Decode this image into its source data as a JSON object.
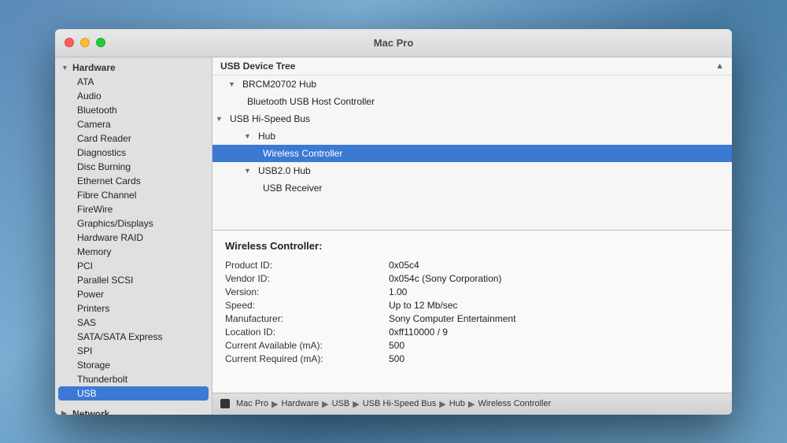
{
  "window": {
    "title": "Mac Pro"
  },
  "sidebar": {
    "sections": [
      {
        "id": "hardware",
        "label": "Hardware",
        "expanded": true,
        "items": [
          {
            "id": "ata",
            "label": "ATA"
          },
          {
            "id": "audio",
            "label": "Audio"
          },
          {
            "id": "bluetooth",
            "label": "Bluetooth"
          },
          {
            "id": "camera",
            "label": "Camera"
          },
          {
            "id": "card-reader",
            "label": "Card Reader"
          },
          {
            "id": "diagnostics",
            "label": "Diagnostics"
          },
          {
            "id": "disc-burning",
            "label": "Disc Burning"
          },
          {
            "id": "ethernet-cards",
            "label": "Ethernet Cards"
          },
          {
            "id": "fibre-channel",
            "label": "Fibre Channel"
          },
          {
            "id": "firewire",
            "label": "FireWire"
          },
          {
            "id": "graphics-displays",
            "label": "Graphics/Displays"
          },
          {
            "id": "hardware-raid",
            "label": "Hardware RAID"
          },
          {
            "id": "memory",
            "label": "Memory"
          },
          {
            "id": "pci",
            "label": "PCI"
          },
          {
            "id": "parallel-scsi",
            "label": "Parallel SCSI"
          },
          {
            "id": "power",
            "label": "Power"
          },
          {
            "id": "printers",
            "label": "Printers"
          },
          {
            "id": "sas",
            "label": "SAS"
          },
          {
            "id": "sata-express",
            "label": "SATA/SATA Express"
          },
          {
            "id": "spi",
            "label": "SPI"
          },
          {
            "id": "storage",
            "label": "Storage"
          },
          {
            "id": "thunderbolt",
            "label": "Thunderbolt"
          },
          {
            "id": "usb",
            "label": "USB",
            "selected": true
          }
        ]
      },
      {
        "id": "network",
        "label": "Network",
        "expanded": false,
        "items": []
      }
    ]
  },
  "tree": {
    "header": "USB Device Tree",
    "items": [
      {
        "id": "hub-brcm",
        "label": "BRCM20702 Hub",
        "indent": 1,
        "triangle": true
      },
      {
        "id": "bt-host",
        "label": "Bluetooth USB Host Controller",
        "indent": 2
      },
      {
        "id": "usb-hispeed",
        "label": "USB Hi-Speed Bus",
        "indent": 0,
        "triangle": true
      },
      {
        "id": "hub",
        "label": "Hub",
        "indent": 1,
        "triangle": true
      },
      {
        "id": "wireless-controller",
        "label": "Wireless Controller",
        "indent": 2,
        "selected": true
      },
      {
        "id": "usb2hub",
        "label": "USB2.0 Hub",
        "indent": 2,
        "triangle": true
      },
      {
        "id": "usb-receiver",
        "label": "USB Receiver",
        "indent": 3
      }
    ]
  },
  "detail": {
    "title": "Wireless Controller:",
    "fields": [
      {
        "key": "Product ID:",
        "value": "0x05c4"
      },
      {
        "key": "Vendor ID:",
        "value": "0x054c  (Sony Corporation)"
      },
      {
        "key": "Version:",
        "value": "1.00"
      },
      {
        "key": "Speed:",
        "value": "Up to 12 Mb/sec"
      },
      {
        "key": "Manufacturer:",
        "value": "Sony Computer Entertainment"
      },
      {
        "key": "Location ID:",
        "value": "0xff110000 / 9"
      },
      {
        "key": "Current Available (mA):",
        "value": "500"
      },
      {
        "key": "Current Required (mA):",
        "value": "500"
      }
    ]
  },
  "breadcrumb": {
    "items": [
      "Mac Pro",
      "Hardware",
      "USB",
      "USB Hi-Speed Bus",
      "Hub",
      "Wireless Controller"
    ]
  },
  "traffic_lights": {
    "close": "close-icon",
    "minimize": "minimize-icon",
    "maximize": "maximize-icon"
  }
}
